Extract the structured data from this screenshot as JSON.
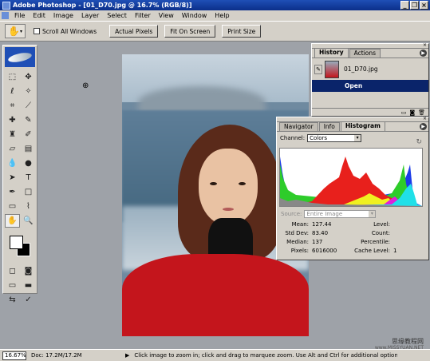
{
  "window": {
    "title": "Adobe Photoshop - [01_D70.jpg @ 16.7% (RGB/8)]"
  },
  "menu": [
    "File",
    "Edit",
    "Image",
    "Layer",
    "Select",
    "Filter",
    "View",
    "Window",
    "Help"
  ],
  "options": {
    "tool_icon": "hand-icon",
    "scroll_all": "Scroll All Windows",
    "actual_pixels": "Actual Pixels",
    "fit_on_screen": "Fit On Screen",
    "print_size": "Print Size"
  },
  "history": {
    "tabs": [
      "History",
      "Actions"
    ],
    "active_tab": "History",
    "snapshot_name": "01_D70.jpg",
    "steps": [
      "Open"
    ]
  },
  "histogram": {
    "tabs": [
      "Navigator",
      "Info",
      "Histogram"
    ],
    "active_tab": "Histogram",
    "channel_label": "Channel:",
    "channel_value": "Colors",
    "source_label": "Source:",
    "source_value": "Entire Image",
    "stats": {
      "mean_label": "Mean:",
      "mean": "127.44",
      "stddev_label": "Std Dev:",
      "stddev": "83.40",
      "median_label": "Median:",
      "median": "137",
      "pixels_label": "Pixels:",
      "pixels": "6016000",
      "level_label": "Level:",
      "level": "",
      "count_label": "Count:",
      "count": "",
      "percentile_label": "Percentile:",
      "percentile": "",
      "cache_label": "Cache Level:",
      "cache": "1"
    },
    "colors": {
      "red": "#e8201c",
      "green": "#2ecc2a",
      "blue": "#1c3ce8",
      "yellow": "#f0f020",
      "cyan": "#20e0e8",
      "magenta": "#e020d8",
      "gray": "#888888"
    }
  },
  "status": {
    "zoom": "16.67%",
    "doc": "Doc: 17.2M/17.2M",
    "hint": "Click image to zoom in; click and drag to marquee zoom.  Use Alt and Ctrl for additional options."
  },
  "watermark": {
    "line1": "思缘教程网",
    "line2": "www.MISSYUAN.NET"
  }
}
